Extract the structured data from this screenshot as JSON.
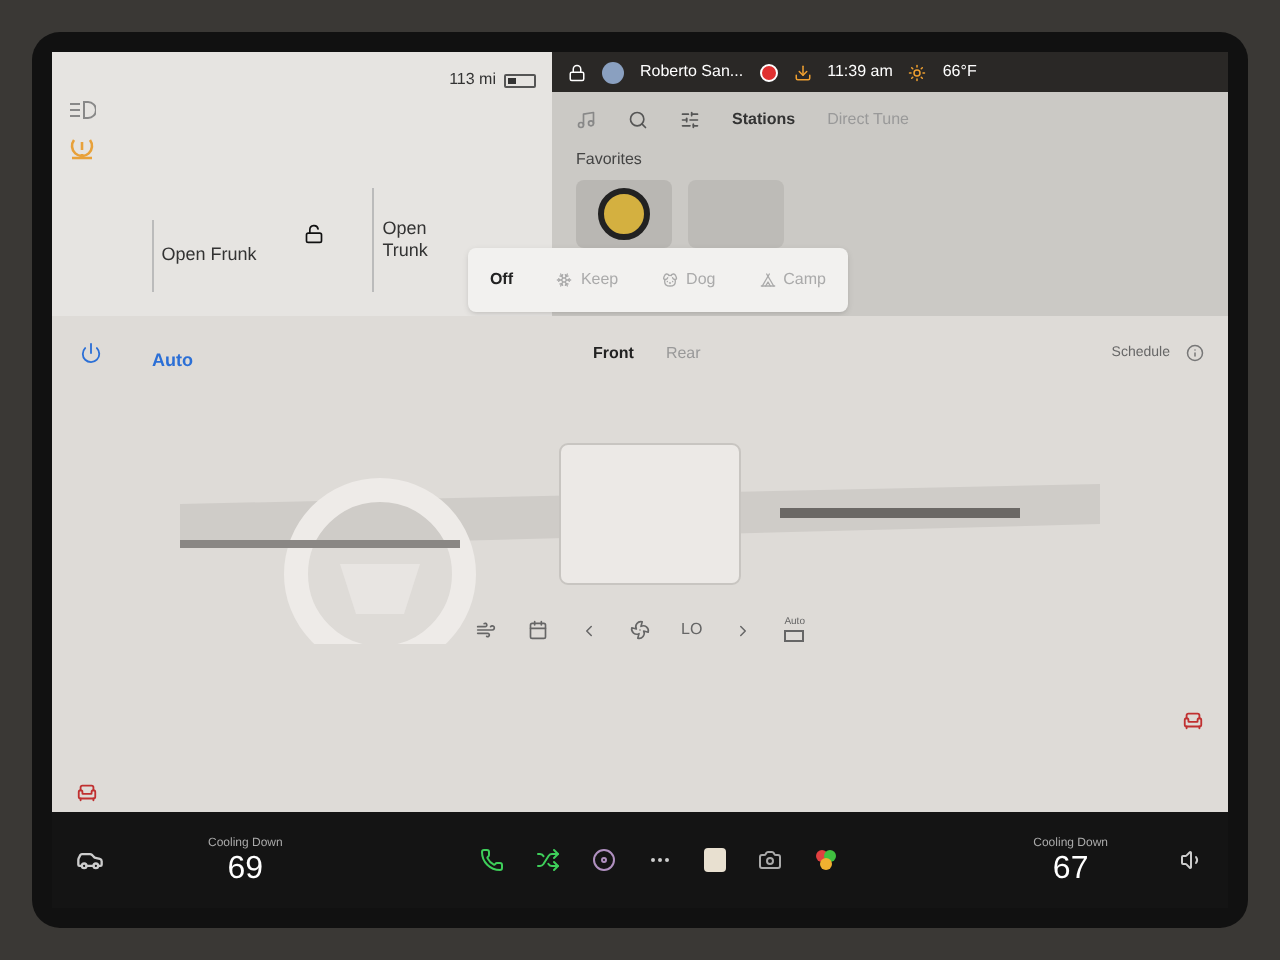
{
  "car_panel": {
    "range": "113 mi",
    "battery": {
      "level": 0.3
    },
    "frunk": "Open Frunk",
    "trunk": "Open Trunk",
    "locked": false
  },
  "status_bar": {
    "user": "Roberto San...",
    "recording": true,
    "time": "11:39 am",
    "temperature": "66°F"
  },
  "media": {
    "tabs": [
      {
        "label": "Stations",
        "selected": true
      },
      {
        "label": "Direct Tune",
        "selected": false
      }
    ],
    "section": "Favorites"
  },
  "climate_modes": [
    {
      "label": "Off",
      "selected": true
    },
    {
      "label": "Keep",
      "selected": false
    },
    {
      "label": "Dog",
      "selected": false
    },
    {
      "label": "Camp",
      "selected": false
    }
  ],
  "climate": {
    "schedule": "Schedule",
    "power_on": true,
    "auto": "Auto",
    "zones": [
      {
        "label": "Front",
        "selected": true
      },
      {
        "label": "Rear",
        "selected": false
      }
    ],
    "fan": "LO",
    "recirc": "Auto"
  },
  "bottom_bar": {
    "driver_status": "Cooling Down",
    "driver_temp": "69",
    "passenger_status": "Cooling Down",
    "passenger_temp": "67"
  }
}
